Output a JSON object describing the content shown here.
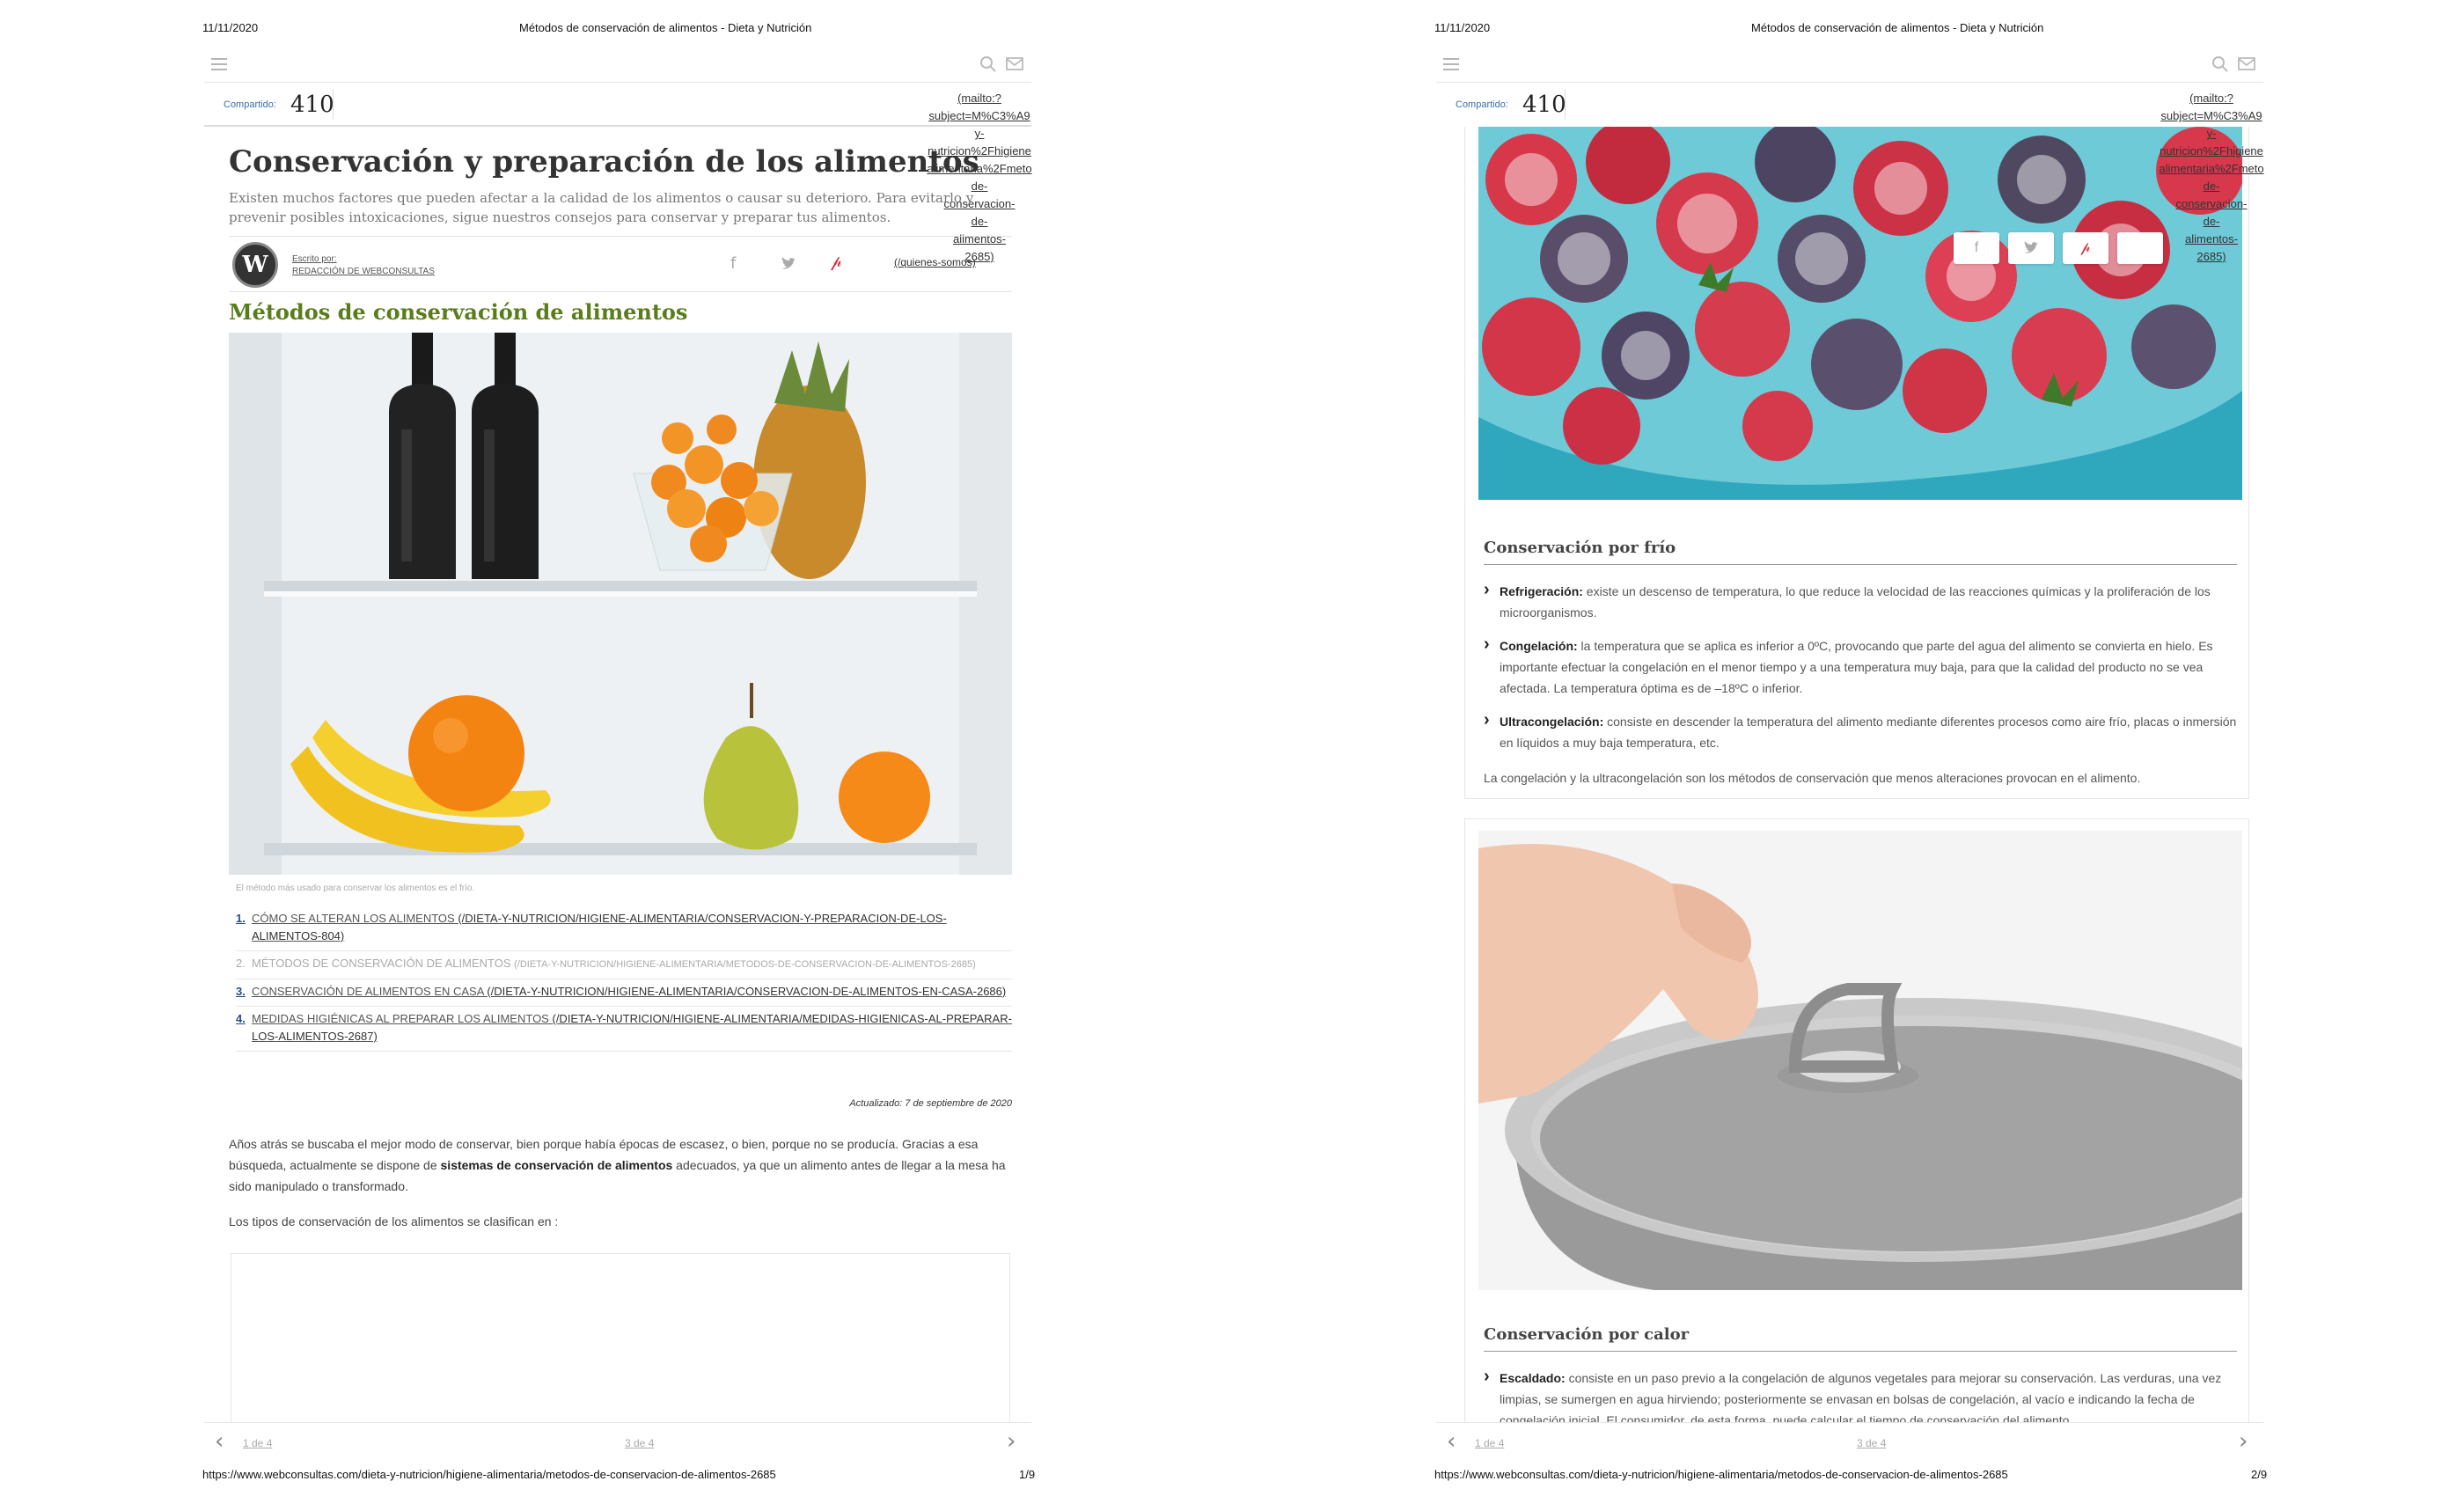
{
  "print": {
    "date": "11/11/2020",
    "title": "Métodos de conservación de alimentos - Dieta y Nutrición",
    "url": "https://www.webconsultas.com/dieta-y-nutricion/higiene-alimentaria/metodos-de-conservacion-de-alimentos-2685",
    "page1": "1/9",
    "page2": "2/9"
  },
  "share": {
    "label": "Compartido:",
    "count": "410",
    "mailto_lines": [
      "(mailto:?",
      "subject=M%C3%A9",
      "y-",
      "nutricion%2Fhigiene",
      "alimentaria%2Fmeto",
      "de-",
      "conservacion-",
      "de-",
      "alimentos-",
      "2685)"
    ],
    "quienes": "(/quienes-somos)"
  },
  "icons": {
    "menu": "menu-icon",
    "search": "search-icon",
    "mail": "mail-icon",
    "facebook": "facebook-icon",
    "twitter": "twitter-icon",
    "pinterest": "pinterest-icon",
    "prev": "chevron-left-icon",
    "next": "chevron-right-icon"
  },
  "article": {
    "title": "Conservación y preparación de los alimentos",
    "subtitle": "Existen muchos factores que pueden afectar a la calidad de los alimentos o causar su deterioro. Para evitarlo y prevenir posibles intoxicaciones, sigue nuestros consejos para conservar y preparar tus alimentos.",
    "author_label": "Escrito por:",
    "author_name": "REDACCIÓN DE WEBCONSULTAS",
    "section_title": "Métodos de conservación de alimentos",
    "image_caption": "El método más usado para conservar los alimentos es el frío.",
    "toc": [
      {
        "num": "1.",
        "text": "CÓMO SE ALTERAN LOS ALIMENTOS",
        "link": "(/DIETA-Y-NUTRICION/HIGIENE-ALIMENTARIA/CONSERVACION-Y-PREPARACION-DE-LOS-ALIMENTOS-804)"
      },
      {
        "num": "2.",
        "text": "MÉTODOS DE CONSERVACIÓN DE ALIMENTOS",
        "link": "(/DIETA-Y-NUTRICION/HIGIENE-ALIMENTARIA/METODOS-DE-CONSERVACION-DE-ALIMENTOS-2685)"
      },
      {
        "num": "3.",
        "text": "CONSERVACIÓN DE ALIMENTOS EN CASA",
        "link": "(/DIETA-Y-NUTRICION/HIGIENE-ALIMENTARIA/CONSERVACION-DE-ALIMENTOS-EN-CASA-2686)"
      },
      {
        "num": "4.",
        "text": "MEDIDAS HIGIÉNICAS AL PREPARAR LOS ALIMENTOS",
        "link": "(/DIETA-Y-NUTRICION/HIGIENE-ALIMENTARIA/MEDIDAS-HIGIENICAS-AL-PREPARAR-LOS-ALIMENTOS-2687)"
      }
    ],
    "updated": "Actualizado: 7 de septiembre de 2020",
    "para1_a": "Años atrás se buscaba el mejor modo de conservar, bien porque había épocas de escasez, o bien, porque no se producía. Gracias a esa búsqueda, actualmente se dispone de ",
    "para1_b": "sistemas de conservación de alimentos",
    "para1_c": " adecuados, ya que un alimento antes de llegar a la mesa ha sido manipulado o transformado.",
    "para2": "Los tipos de conservación de los alimentos se clasifican en :"
  },
  "pager": {
    "prev_label": "1 de 4",
    "current_label": "3 de 4"
  },
  "cold": {
    "heading": "Conservación por frío",
    "items": [
      {
        "term": "Refrigeración:",
        "text": " existe un descenso de temperatura, lo que reduce la velocidad de las reacciones químicas y la proliferación de los microorganismos."
      },
      {
        "term": "Congelación:",
        "text": " la temperatura que se aplica es inferior a 0ºC, provocando que parte del agua del alimento se convierta en hielo. Es importante efectuar la congelación en el menor tiempo y a una temperatura muy baja, para que la calidad del producto no se vea afectada. La temperatura óptima es de –18ºC o inferior."
      },
      {
        "term": "Ultracongelación:",
        "text": " consiste en descender la temperatura del alimento mediante diferentes procesos como aire frío, placas o inmersión en líquidos a muy baja temperatura, etc."
      }
    ],
    "note": "La congelación y la ultracongelación son los métodos de conservación que menos alteraciones provocan en el alimento."
  },
  "heat": {
    "heading": "Conservación por calor",
    "items": [
      {
        "term": "Escaldado:",
        "text": " consiste en un paso previo a la congelación de algunos vegetales para mejorar su conservación. Las verduras, una vez limpias, se sumergen en agua hirviendo; posteriormente se envasan en bolsas de congelación, al vacío e indicando la fecha de congelación inicial. El consumidor, de esta forma, puede calcular el tiempo de conservación del alimento."
      }
    ]
  },
  "colors": {
    "section_green": "#5a7d1c",
    "share_blue": "#3a6fb0",
    "pinterest_red": "#c8232c"
  }
}
